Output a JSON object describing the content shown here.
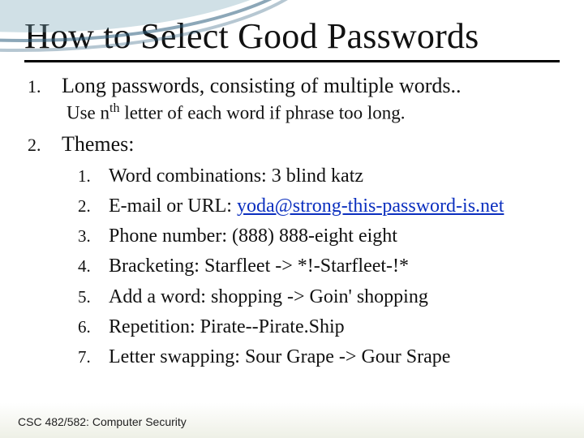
{
  "title": "How to Select Good Passwords",
  "item1": {
    "num": "1.",
    "text": "Long passwords, consisting of multiple words..",
    "subline_pre": "Use n",
    "subline_sup": "th",
    "subline_post": " letter of each word if phrase too long."
  },
  "item2": {
    "num": "2.",
    "text": "Themes:",
    "subitems": [
      {
        "num": "1.",
        "text": "Word combinations: 3 blind katz"
      },
      {
        "num": "2.",
        "prefix": "E-mail or URL: ",
        "link": "yoda@strong-this-password-is.net"
      },
      {
        "num": "3.",
        "text": "Phone number: (888) 888-eight eight"
      },
      {
        "num": "4.",
        "text": "Bracketing: Starfleet -> *!-Starfleet-!*"
      },
      {
        "num": "5.",
        "text": "Add a word: shopping -> Goin' shopping"
      },
      {
        "num": "6.",
        "text": "Repetition: Pirate--Pirate.Ship"
      },
      {
        "num": "7.",
        "text": "Letter swapping: Sour Grape -> Gour Srape"
      }
    ]
  },
  "footer": "CSC 482/582: Computer Security"
}
